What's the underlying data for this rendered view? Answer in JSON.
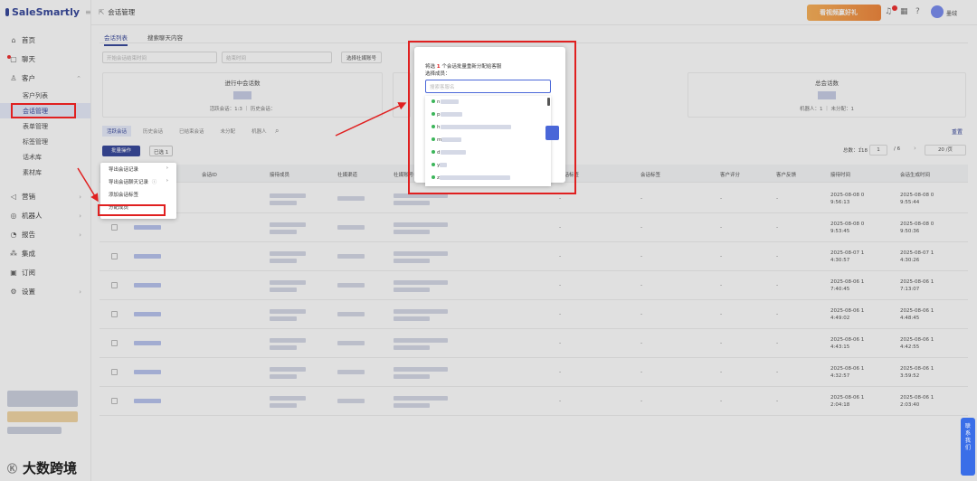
{
  "app": {
    "logo": "SaleSmartly"
  },
  "sidebar": {
    "items": [
      {
        "icon": "home-icon",
        "label": "首页",
        "glyph": "⌂"
      },
      {
        "icon": "chat-icon",
        "label": "聊天",
        "glyph": "▢"
      },
      {
        "icon": "customer-icon",
        "label": "客户",
        "glyph": "♙"
      },
      {
        "icon": "marketing-icon",
        "label": "营销",
        "glyph": "◁"
      },
      {
        "icon": "robot-icon",
        "label": "机器人",
        "glyph": "◎"
      },
      {
        "icon": "report-icon",
        "label": "报告",
        "glyph": "◔"
      },
      {
        "icon": "integration-icon",
        "label": "集成",
        "glyph": "⁂"
      },
      {
        "icon": "subscription-icon",
        "label": "订阅",
        "glyph": "▣"
      },
      {
        "icon": "settings-icon",
        "label": "设置",
        "glyph": "⚙"
      }
    ],
    "sub_items": [
      "客户列表",
      "会话管理",
      "表单管理",
      "标签管理",
      "话术库",
      "素材库"
    ],
    "active_sub": "会话管理"
  },
  "topbar": {
    "breadcrumb": "会话管理",
    "banner": "看视频赢好礼",
    "user": "墨绒"
  },
  "tabs": [
    "会话列表",
    "搜索聊天内容"
  ],
  "filters": {
    "start_placeholder": "开始会话结束时间",
    "end_placeholder": "结束时间",
    "button": "选择社媒账号"
  },
  "stats": [
    {
      "title": "进行中会话数",
      "foot": "活跃会话：1:3  ｜  历史会话："
    },
    {
      "title": "总会话数",
      "foot": "机器人：1  ｜  未分配：1"
    }
  ],
  "chips": [
    "活跃会话",
    "历史会话",
    "已结束会话",
    "未分配",
    "机器人"
  ],
  "toolbar": {
    "batch_label": "批量操作",
    "selected_label": "已选 1",
    "reset_label": "重置"
  },
  "pager": {
    "total": "总数：118",
    "page": "1",
    "pages": "/ 6",
    "page_size": "20 /页"
  },
  "table": {
    "headers": [
      "会话ID",
      "接待成员",
      "社媒渠道",
      "社媒账号名",
      "会话标签",
      "会话标签",
      "客户评分",
      "客户反馈",
      "接待时间",
      "会话生成时间"
    ],
    "dash": "-",
    "rows": [
      {
        "t1": "2025-08-08 0\n9:56:13",
        "t2": "2025-08-08 0\n9:55:44"
      },
      {
        "t1": "2025-08-08 0\n9:53:45",
        "t2": "2025-08-08 0\n9:50:36"
      },
      {
        "t1": "2025-08-07 1\n4:30:57",
        "t2": "2025-08-07 1\n4:30:26"
      },
      {
        "t1": "2025-08-06 1\n7:40:45",
        "t2": "2025-08-06 1\n7:13:07"
      },
      {
        "t1": "2025-08-06 1\n4:49:02",
        "t2": "2025-08-06 1\n4:48:45"
      },
      {
        "t1": "2025-08-06 1\n4:43:15",
        "t2": "2025-08-06 1\n4:42:55"
      },
      {
        "t1": "2025-08-06 1\n4:32:57",
        "t2": "2025-08-06 1\n3:59:52"
      },
      {
        "t1": "2025-08-06 1\n2:04:18",
        "t2": "2025-08-06 1\n2:03:40"
      }
    ]
  },
  "dropdown": {
    "items": [
      "导出会话记录",
      "导出会话聊天记录",
      "添加会话标签",
      "分配成员"
    ]
  },
  "modal": {
    "msg_prefix": "将选",
    "msg_count": "1",
    "msg_suffix": "个会话批量重新分配给客服",
    "label": "选择成员：",
    "search_placeholder": "搜索客服名",
    "options": [
      "n",
      "p",
      "h",
      "m",
      "d",
      "y",
      "z"
    ]
  },
  "contact": "联系我们",
  "watermark": "大数跨境",
  "colors": {
    "brand": "#3a4a9c",
    "annotation_red": "#e02020",
    "online_green": "#3cb55a"
  }
}
